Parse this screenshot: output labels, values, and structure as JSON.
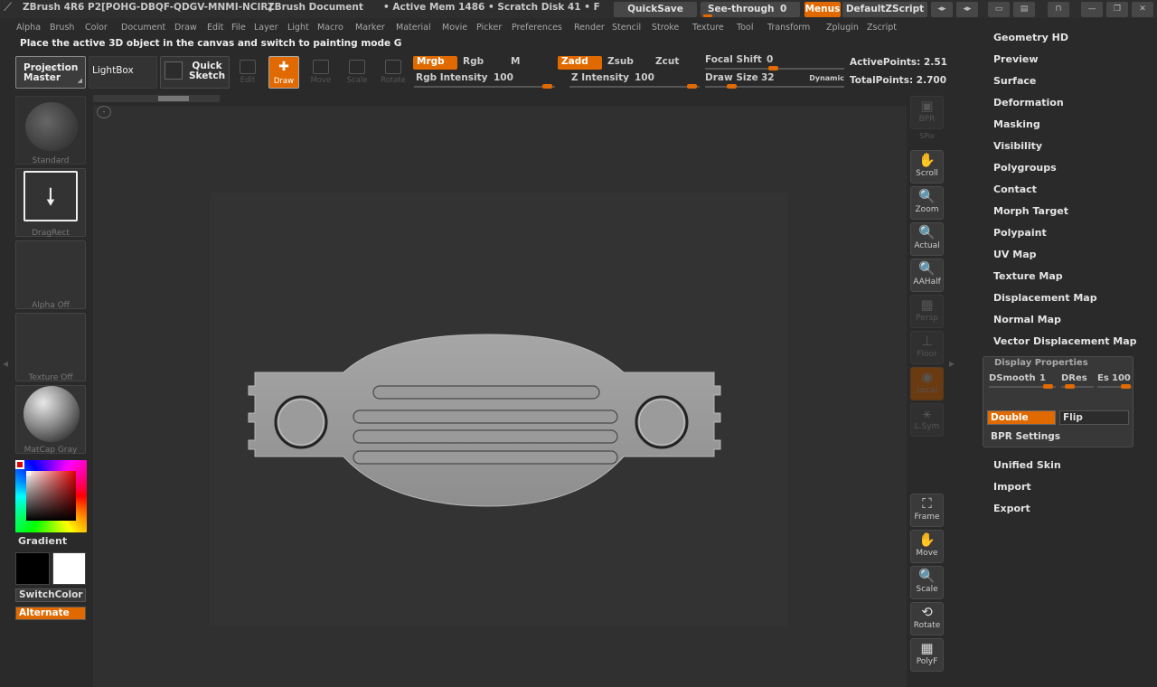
{
  "titlebar": {
    "app": "ZBrush 4R6 P2[POHG-DBQF-QDGV-MNMI-NCIR]",
    "document": "ZBrush Document",
    "active_mem": "• Active Mem 1486 • Scratch Disk 41 • F",
    "quicksave": "QuickSave",
    "see_through": "See-through",
    "see_through_value": "0",
    "menus": "Menus",
    "default_zscript": "DefaultZScript"
  },
  "menubar": [
    "Alpha",
    "Brush",
    "Color",
    "Document",
    "Draw",
    "Edit",
    "File",
    "Layer",
    "Light",
    "Macro",
    "Marker",
    "Material",
    "Movie",
    "Picker",
    "Preferences",
    "Render",
    "Stencil",
    "Stroke",
    "Texture",
    "Tool",
    "Transform",
    "Zplugin",
    "Zscript"
  ],
  "hint": "Place the active 3D object in the canvas and switch to painting mode  G",
  "toolbar": {
    "projection_master": "Projection Master",
    "lightbox": "LightBox",
    "quick_sketch": "Quick Sketch",
    "tools": [
      {
        "label": "Edit",
        "state": "dim"
      },
      {
        "label": "Draw",
        "state": "active"
      },
      {
        "label": "Move",
        "state": "dim"
      },
      {
        "label": "Scale",
        "state": "dim"
      },
      {
        "label": "Rotate",
        "state": "dim"
      }
    ],
    "mrgb": "Mrgb",
    "rgb": "Rgb",
    "m": "M",
    "zadd": "Zadd",
    "zsub": "Zsub",
    "zcut": "Zcut",
    "rgb_intensity_label": "Rgb Intensity",
    "rgb_intensity": "100",
    "z_intensity_label": "Z Intensity",
    "z_intensity": "100",
    "focal_shift_label": "Focal Shift",
    "focal_shift": "0",
    "draw_size_label": "Draw Size",
    "draw_size": "32",
    "dynamic": "Dynamic",
    "active_points": "ActivePoints: 2.51",
    "total_points": "TotalPoints: 2.700"
  },
  "left_shelf": {
    "brush": "Standard",
    "stroke": "DragRect",
    "alpha": "Alpha  Off",
    "texture": "Texture  Off",
    "material": "MatCap  Gray",
    "gradient": "Gradient",
    "switch_color": "SwitchColor",
    "alternate": "Alternate",
    "colors": {
      "main": "#e00000",
      "secondary": "#000000",
      "gradient_b": "#ffffff"
    }
  },
  "right_shelf": [
    {
      "label": "BPR",
      "icon": "render-icon",
      "state": "dim"
    },
    {
      "label": "SPix",
      "icon": "spix-icon",
      "state": "dim"
    },
    {
      "label": "Scroll",
      "icon": "hand-icon",
      "state": "on"
    },
    {
      "label": "Zoom",
      "icon": "magnifier-icon",
      "state": "on"
    },
    {
      "label": "Actual",
      "icon": "magnifier-icon",
      "state": "on"
    },
    {
      "label": "AAHalf",
      "icon": "magnifier-icon",
      "state": "on"
    },
    {
      "label": "Persp",
      "icon": "grid-icon",
      "state": "dim"
    },
    {
      "label": "Floor",
      "icon": "floor-icon",
      "state": "dim"
    },
    {
      "label": "Local",
      "icon": "local-icon",
      "state": "dim"
    },
    {
      "label": "L.Sym",
      "icon": "sym-icon",
      "state": "dim"
    },
    {
      "label": "Frame",
      "icon": "frame-icon",
      "state": "on"
    },
    {
      "label": "Move",
      "icon": "hand-icon",
      "state": "on"
    },
    {
      "label": "Scale",
      "icon": "magnifier-icon",
      "state": "on"
    },
    {
      "label": "Rotate",
      "icon": "rotate-icon",
      "state": "on"
    },
    {
      "label": "PolyF",
      "icon": "polyframe-icon",
      "state": "on"
    }
  ],
  "tool_panel": {
    "items_top": [
      "Geometry HD",
      "Preview",
      "Surface",
      "Deformation",
      "Masking",
      "Visibility",
      "Polygroups",
      "Contact",
      "Morph Target",
      "Polypaint",
      "UV Map",
      "Texture Map",
      "Displacement Map",
      "Normal Map",
      "Vector Displacement Map"
    ],
    "display_properties": {
      "title": "Display Properties",
      "dsmooth_label": "DSmooth",
      "dsmooth": "1",
      "dres_label": "DRes",
      "es_label": "Es",
      "es": "100",
      "double": "Double",
      "flip": "Flip",
      "bpr_settings": "BPR Settings"
    },
    "items_bottom": [
      "Unified Skin",
      "Import",
      "Export"
    ]
  },
  "accent": "#e06a00"
}
